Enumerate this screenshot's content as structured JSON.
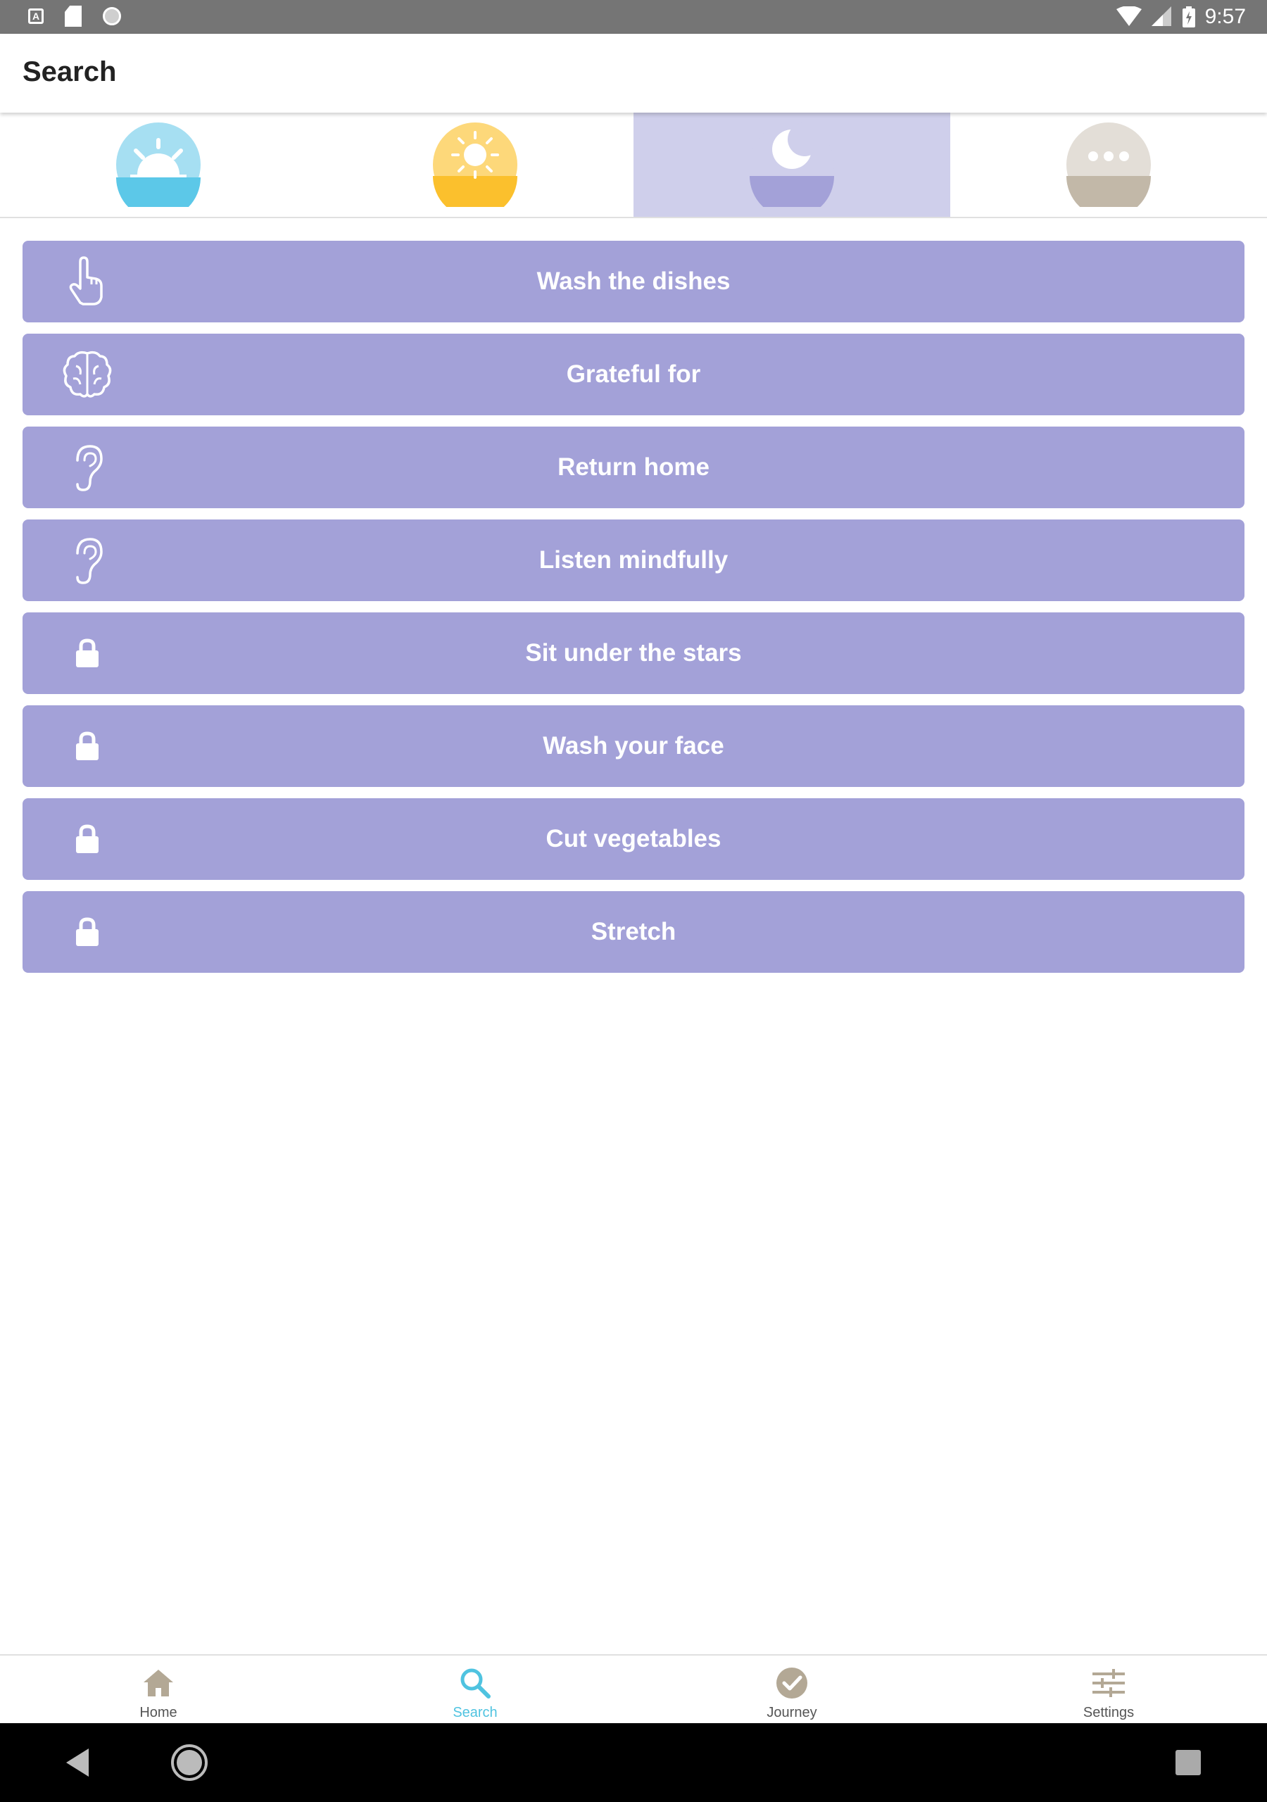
{
  "status_bar": {
    "time": "9:57",
    "left_icons": [
      "keyboard-a-icon",
      "sd-card-icon",
      "circle-icon"
    ],
    "right_icons": [
      "wifi-icon",
      "signal-icon",
      "battery-icon"
    ]
  },
  "app_bar": {
    "title": "Search"
  },
  "tabs": [
    {
      "name": "sunrise",
      "icon": "sunrise-icon",
      "selected": false,
      "color": "#5cc8e8"
    },
    {
      "name": "midday",
      "icon": "sun-icon",
      "selected": false,
      "color": "#fbc02d"
    },
    {
      "name": "night",
      "icon": "moon-icon",
      "selected": true,
      "color": "#a3a1d8"
    },
    {
      "name": "other",
      "icon": "more-icon",
      "selected": false,
      "color": "#c2b8a8"
    }
  ],
  "activities": [
    {
      "label": "Wash the dishes",
      "icon": "hand-pointer-icon",
      "locked": false
    },
    {
      "label": "Grateful for",
      "icon": "brain-icon",
      "locked": false
    },
    {
      "label": "Return home",
      "icon": "ear-icon",
      "locked": false
    },
    {
      "label": "Listen mindfully",
      "icon": "ear-icon",
      "locked": false
    },
    {
      "label": "Sit under the stars",
      "icon": "lock-icon",
      "locked": true
    },
    {
      "label": "Wash your face",
      "icon": "lock-icon",
      "locked": true
    },
    {
      "label": "Cut vegetables",
      "icon": "lock-icon",
      "locked": true
    },
    {
      "label": "Stretch",
      "icon": "lock-icon",
      "locked": true
    }
  ],
  "bottom_nav": [
    {
      "label": "Home",
      "icon": "home-icon",
      "active": false
    },
    {
      "label": "Search",
      "icon": "search-icon",
      "active": true
    },
    {
      "label": "Journey",
      "icon": "check-circle-icon",
      "active": false
    },
    {
      "label": "Settings",
      "icon": "sliders-icon",
      "active": false
    }
  ],
  "colors": {
    "activity_bg": "#a3a1d8",
    "selected_tab_bg": "#cfcfeb",
    "active_nav": "#4fc3e0",
    "inactive_nav_icon": "#b3a895"
  }
}
